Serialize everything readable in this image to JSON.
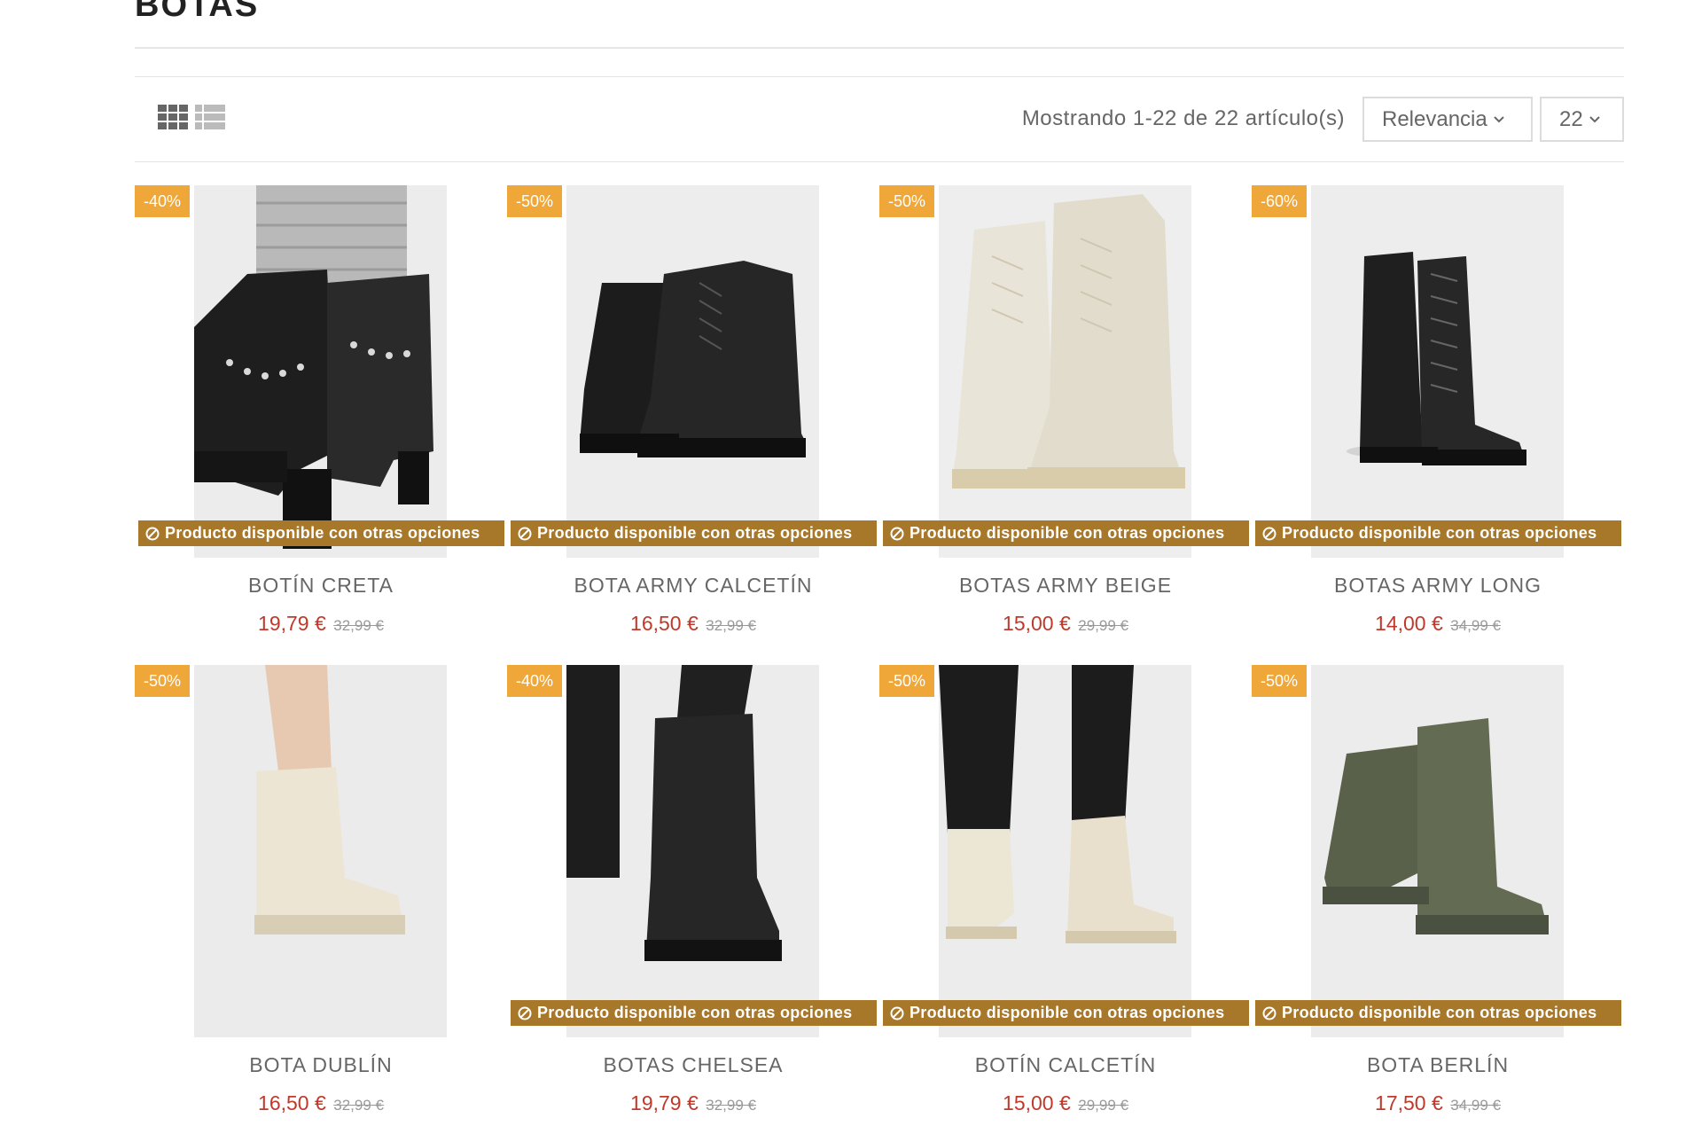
{
  "page": {
    "title": "BOTAS"
  },
  "toolbar": {
    "count_text": "Mostrando 1-22 de 22 artículo(s)",
    "sort_value": "Relevancia",
    "per_page_value": "22",
    "view_icons": [
      "grid-view-icon",
      "list-view-icon"
    ]
  },
  "colors": {
    "discount_badge": "#f0a73a",
    "availability_banner": "#a8782a",
    "price": "#c0392b"
  },
  "availability_label": "Producto disponible con otras opciones",
  "products": [
    {
      "name": "BOTÍN CRETA",
      "price": "19,79 €",
      "old_price": "32,99 €",
      "discount": "-40%",
      "shows_availability": true,
      "image": "studded-black-ankle-boots-photo"
    },
    {
      "name": "BOTA ARMY CALCETÍN",
      "price": "16,50 €",
      "old_price": "32,99 €",
      "discount": "-50%",
      "shows_availability": true,
      "image": "black-army-sock-boots-photo"
    },
    {
      "name": "BOTAS ARMY BEIGE",
      "price": "15,00 €",
      "old_price": "29,99 €",
      "discount": "-50%",
      "shows_availability": true,
      "image": "beige-army-boots-photo"
    },
    {
      "name": "BOTAS ARMY LONG",
      "price": "14,00 €",
      "old_price": "34,99 €",
      "discount": "-60%",
      "shows_availability": true,
      "image": "black-long-lace-boots-photo"
    },
    {
      "name": "BOTA DUBLÍN",
      "price": "16,50 €",
      "old_price": "32,99 €",
      "discount": "-50%",
      "shows_availability": false,
      "image": "cream-dublin-boot-photo"
    },
    {
      "name": "BOTAS CHELSEA",
      "price": "19,79 €",
      "old_price": "32,99 €",
      "discount": "-40%",
      "shows_availability": true,
      "image": "black-chelsea-boot-photo"
    },
    {
      "name": "BOTÍN CALCETÍN",
      "price": "15,00 €",
      "old_price": "29,99 €",
      "discount": "-50%",
      "shows_availability": true,
      "image": "cream-sock-bootie-photo"
    },
    {
      "name": "BOTA BERLÍN",
      "price": "17,50 €",
      "old_price": "34,99 €",
      "discount": "-50%",
      "shows_availability": true,
      "image": "khaki-berlin-boot-photo"
    }
  ]
}
